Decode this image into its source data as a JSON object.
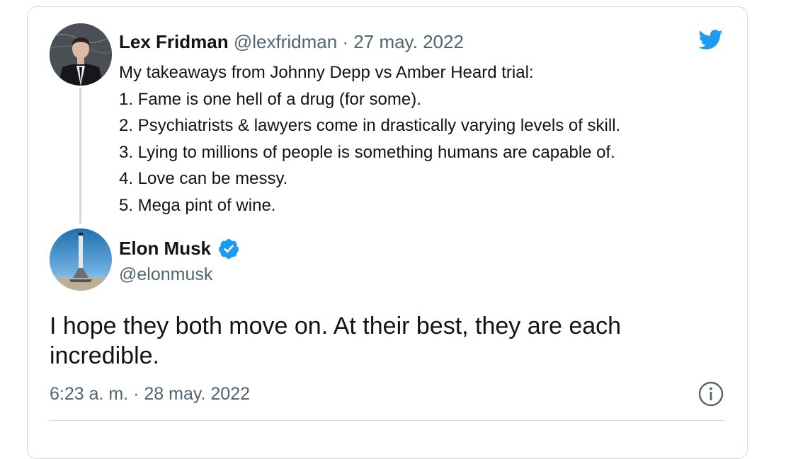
{
  "quoted_tweet": {
    "author_name": "Lex Fridman",
    "author_handle": "@lexfridman",
    "separator": "·",
    "date": "27 may. 2022",
    "lines": [
      "My takeaways from Johnny Depp vs Amber Heard trial:",
      "1. Fame is one hell of a drug (for some).",
      "2. Psychiatrists & lawyers come in drastically varying levels of skill.",
      "3. Lying to millions of people is something humans are capable of.",
      "4. Love can be messy.",
      "5. Mega pint of wine."
    ],
    "avatar_icon": "person-avatar"
  },
  "reply_tweet": {
    "author_name": "Elon Musk",
    "author_handle": "@elonmusk",
    "verified_icon": "verified-badge-icon",
    "text": "I hope they both move on. At their best, they are each incredible.",
    "timestamp": "6:23 a. m. · 28 may. 2022",
    "avatar_icon": "rocket-avatar"
  },
  "icons": {
    "brand": "twitter-bird-icon",
    "info": "info-icon"
  },
  "colors": {
    "twitter_blue": "#1d9bf0",
    "secondary_text": "#536471",
    "primary_text": "#0f1419",
    "border": "#cfd9de"
  }
}
